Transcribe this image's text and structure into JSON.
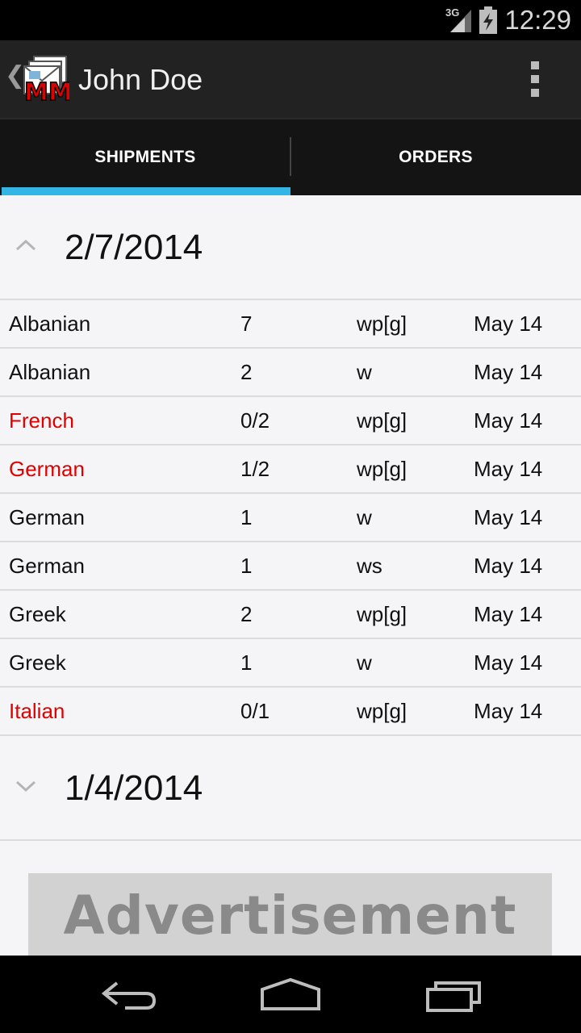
{
  "status_bar": {
    "network": "3G",
    "time": "12:29",
    "icons": [
      "signal-icon",
      "battery-icon"
    ]
  },
  "action_bar": {
    "title": "John Doe",
    "app_icon_text": "MM",
    "icons": [
      "up-caret-icon",
      "app-icon",
      "overflow-menu-icon"
    ]
  },
  "tabs": [
    {
      "label": "SHIPMENTS",
      "selected": true
    },
    {
      "label": "ORDERS",
      "selected": false
    }
  ],
  "accent_color": "#33b5e5",
  "highlight_color": "#e00000",
  "groups": [
    {
      "date": "2/7/2014",
      "expanded": true,
      "rows": [
        {
          "language": "Albanian",
          "qty": "7",
          "type": "wp[g]",
          "month": "May 14",
          "highlight": false
        },
        {
          "language": "Albanian",
          "qty": "2",
          "type": "w",
          "month": "May 14",
          "highlight": false
        },
        {
          "language": "French",
          "qty": "0/2",
          "type": "wp[g]",
          "month": "May 14",
          "highlight": true
        },
        {
          "language": "German",
          "qty": "1/2",
          "type": "wp[g]",
          "month": "May 14",
          "highlight": true
        },
        {
          "language": "German",
          "qty": "1",
          "type": "w",
          "month": "May 14",
          "highlight": false
        },
        {
          "language": "German",
          "qty": "1",
          "type": "ws",
          "month": "May 14",
          "highlight": false
        },
        {
          "language": "Greek",
          "qty": "2",
          "type": "wp[g]",
          "month": "May 14",
          "highlight": false
        },
        {
          "language": "Greek",
          "qty": "1",
          "type": "w",
          "month": "May 14",
          "highlight": false
        },
        {
          "language": "Italian",
          "qty": "0/1",
          "type": "wp[g]",
          "month": "May 14",
          "highlight": true
        }
      ]
    },
    {
      "date": "1/4/2014",
      "expanded": false,
      "rows": []
    }
  ],
  "advertisement": {
    "text": "Advertisement"
  },
  "nav_bar": {
    "icons": [
      "back-icon",
      "home-icon",
      "recents-icon"
    ]
  }
}
